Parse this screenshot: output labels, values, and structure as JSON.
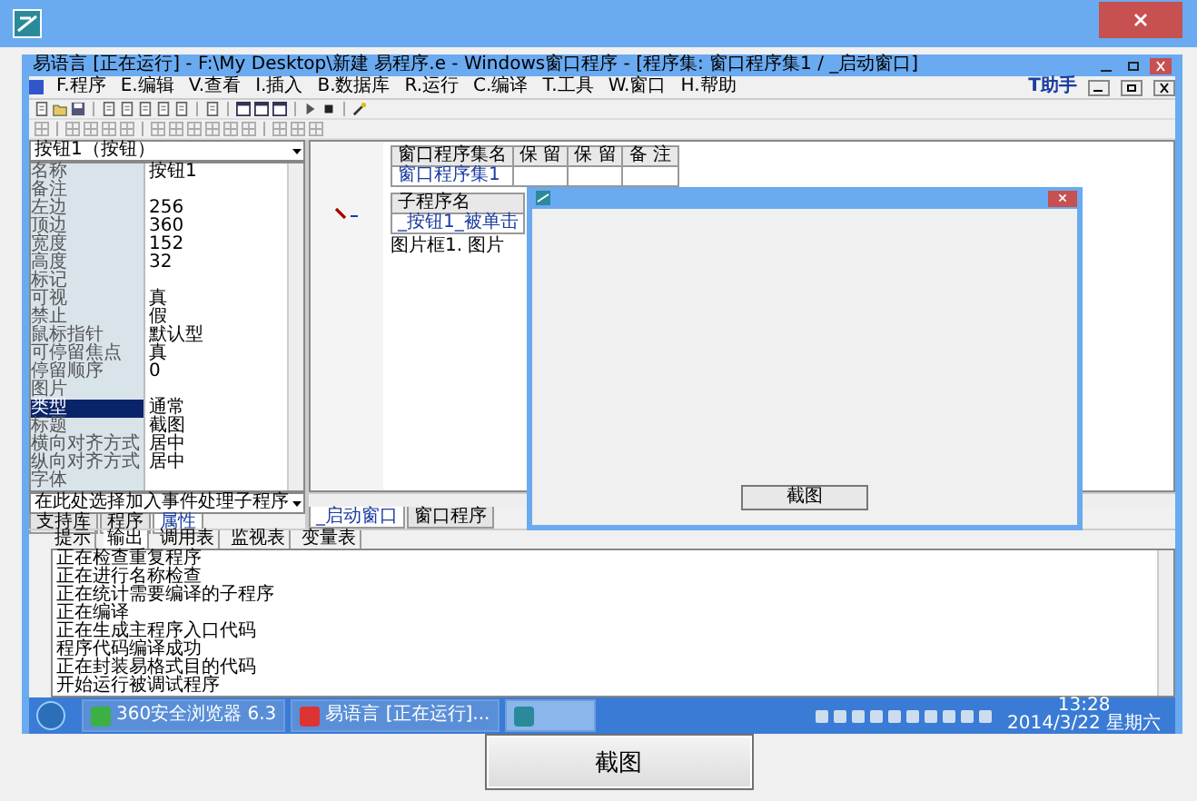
{
  "ide": {
    "title": "易语言 [正在运行] - F:\\My Desktop\\新建 易程序.e - Windows窗口程序 - [程序集: 窗口程序集1 / _启动窗口]",
    "menu": [
      "F.程序",
      "E.编辑",
      "V.查看",
      "I.插入",
      "B.数据库",
      "R.运行",
      "C.编译",
      "T.工具",
      "W.窗口",
      "H.帮助"
    ],
    "assistant": "T助手",
    "properties": {
      "object": "按钮1（按钮）",
      "rows": [
        {
          "name": "名称",
          "value": "按钮1",
          "selected": false
        },
        {
          "name": "备注",
          "selected": false
        },
        {
          "name": "左边",
          "value": "256",
          "selected": false
        },
        {
          "name": "顶边",
          "value": "360",
          "selected": false
        },
        {
          "name": "宽度",
          "value": "152",
          "selected": false
        },
        {
          "name": "高度",
          "value": "32",
          "selected": false
        },
        {
          "name": "标记",
          "selected": false
        },
        {
          "name": "可视",
          "value": "真",
          "selected": false
        },
        {
          "name": "禁止",
          "value": "假",
          "selected": false
        },
        {
          "name": "鼠标指针",
          "value": "默认型",
          "selected": false
        },
        {
          "name": "可停留焦点",
          "value": "真",
          "selected": false
        },
        {
          "name": "停留顺序",
          "value": "0",
          "selected": false
        },
        {
          "name": "图片",
          "selected": false
        },
        {
          "name": "类型",
          "value": "通常",
          "selected": true
        },
        {
          "name": "标题",
          "value": "截图",
          "selected": false
        },
        {
          "name": "横向对齐方式",
          "value": "居中",
          "selected": false
        },
        {
          "name": "纵向对齐方式",
          "value": "居中",
          "selected": false
        },
        {
          "name": "字体",
          "selected": false
        }
      ],
      "event_hint": "在此处选择加入事件处理子程序",
      "tabs": [
        {
          "label": "支持库",
          "selected": false
        },
        {
          "label": "程序",
          "selected": false
        },
        {
          "label": "属性",
          "selected": true
        }
      ]
    },
    "code": {
      "columns": [
        "窗口程序集名",
        "保 留",
        "保 留",
        "备 注"
      ],
      "rows": [
        [
          "窗口程序集1"
        ]
      ],
      "sub_header": "子程序名",
      "sub_name": "_按钮1_被单击",
      "code_line": "图片框1. 图片",
      "tabs": [
        {
          "label": "_启动窗口",
          "selected": true
        },
        {
          "label": "窗口程序",
          "selected": false
        }
      ]
    },
    "running_window": {
      "button": "截图"
    },
    "output": {
      "tabs": [
        {
          "label": "提示",
          "selected": false
        },
        {
          "label": "输出",
          "selected": true
        },
        {
          "label": "调用表",
          "selected": false
        },
        {
          "label": "监视表",
          "selected": false
        },
        {
          "label": "变量表",
          "selected": false
        }
      ],
      "lines": [
        "正在检查重复程序",
        "正在进行名称检查",
        "正在统计需要编译的子程序",
        "正在编译",
        "正在生成主程序入口代码",
        "程序代码编译成功",
        "正在封装易格式目的代码",
        "开始运行被调试程序"
      ]
    },
    "taskbar": {
      "items": [
        {
          "label": "360安全浏览器 6.3",
          "selected": false
        },
        {
          "label": "易语言 [正在运行]...",
          "selected": false
        },
        {
          "selected": true
        }
      ],
      "time": "13:28",
      "date": "2014/3/22 星期六"
    }
  },
  "button": "截图"
}
